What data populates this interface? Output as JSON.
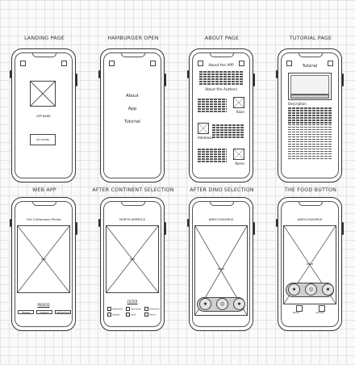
{
  "screens": [
    {
      "caption": "LANDING PAGE"
    },
    {
      "caption": "HAMBURGER OPEN"
    },
    {
      "caption": "ABOUT PAGE"
    },
    {
      "caption": "TUTORIAL PAGE"
    },
    {
      "caption": "WEB APP"
    },
    {
      "caption": "AFTER CONTINENT SELECTION"
    },
    {
      "caption": "AFTER DINO SELECTION"
    },
    {
      "caption": "THE FOOD BUTTON"
    }
  ],
  "landing": {
    "app_name": "APP NAME",
    "button": "GET STARTED"
  },
  "menu": {
    "items": [
      "About",
      "App",
      "Tutorial"
    ]
  },
  "about": {
    "title": "About the APP",
    "authors_title": "About the Authors",
    "authors": [
      "Kaan",
      "Adameon",
      "Koren"
    ]
  },
  "tutorial": {
    "title": "Tutorial",
    "description_label": "Description"
  },
  "webapp": {
    "period_title": "The Cretaceous Period",
    "map_label": "MAP",
    "footer_label": "PERIOD",
    "buttons": [
      "TRIASSIC",
      "JURASSIC",
      "CRETACEOUS"
    ]
  },
  "continent": {
    "title": "NORTH AMERICA",
    "map_label": "MAP",
    "filter_label": "FILTER",
    "filters": [
      "Herbivore",
      "Carnivore",
      "Omnivore",
      "Aquatic",
      "Land",
      "Aerial"
    ]
  },
  "dino": {
    "title": "ANKYLOSAURUS",
    "image_label": "IMAGE",
    "icons": [
      "✱",
      "☺",
      "✱"
    ]
  },
  "food": {
    "title": "ANKYLOSAURUS",
    "image_label": "IMAGE",
    "icons": [
      "✱",
      "☺",
      "✱"
    ],
    "bottom_labels": [
      "Plants",
      "Animals"
    ]
  }
}
